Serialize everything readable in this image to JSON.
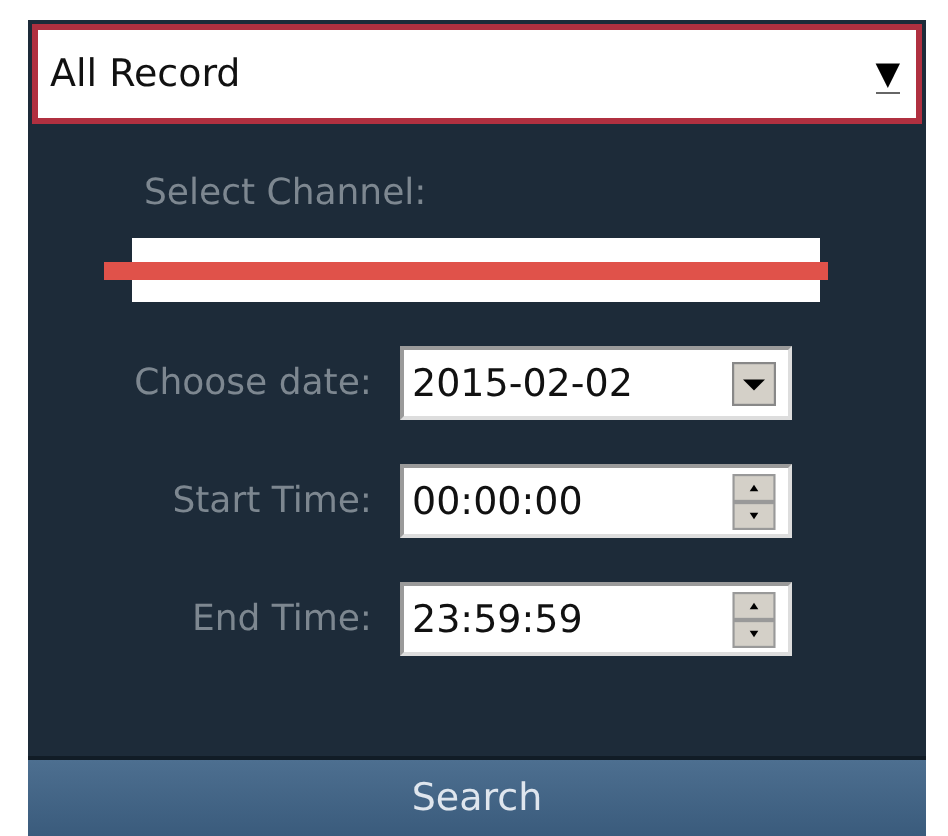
{
  "record_type": {
    "value": "All Record",
    "arrow": "▼"
  },
  "channel": {
    "label": "Select Channel:"
  },
  "fields": [
    {
      "kind": "date",
      "label": "Choose date:",
      "value": "2015-02-02"
    },
    {
      "kind": "time",
      "label": "Start Time:",
      "value": "00:00:00"
    },
    {
      "kind": "time",
      "label": "End Time:",
      "value": "23:59:59"
    }
  ],
  "search_button": "Search"
}
